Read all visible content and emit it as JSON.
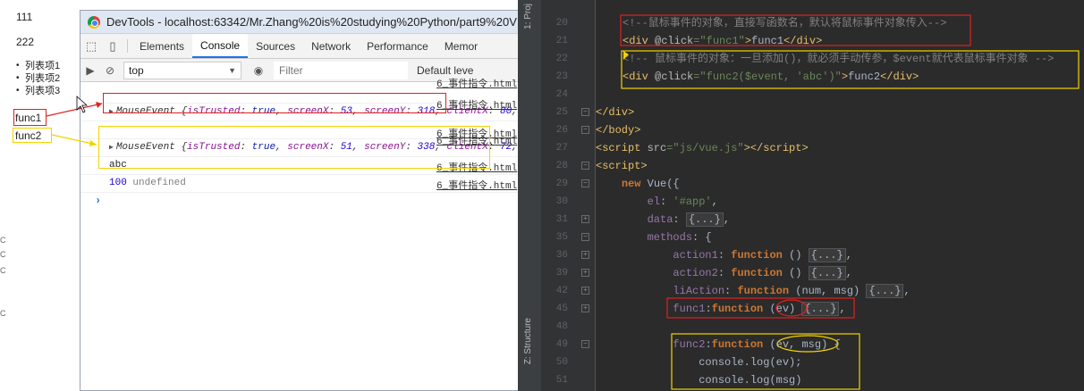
{
  "page": {
    "text_111": "111",
    "text_222": "222",
    "list": [
      "列表项1",
      "列表项2",
      "列表项3"
    ],
    "func1": "func1",
    "func2": "func2",
    "edge_chars": [
      "C",
      "C",
      "C",
      "C"
    ]
  },
  "devtools": {
    "title": "DevTools - localhost:63342/Mr.Zhang%20is%20studying%20Python/part9%20V",
    "tabs": [
      "Elements",
      "Console",
      "Sources",
      "Network",
      "Performance",
      "Memor"
    ],
    "active_tab": "Console",
    "context": "top",
    "filter_placeholder": "Filter",
    "levels": "Default leve",
    "rows": [
      {
        "kind": "object",
        "prefix": "MouseEvent {",
        "k1": "isTrusted",
        "v1": "true",
        "k2": "screenX",
        "v2": "53",
        "k3": "screenY",
        "v3": "318",
        "k4": "clientX",
        "v4": "80",
        "source_top": "6_事件指令.html",
        "source": "6_事件指令.html"
      },
      {
        "kind": "object",
        "prefix": "MouseEvent {",
        "k1": "isTrusted",
        "v1": "true",
        "k2": "screenX",
        "v2": "51",
        "k3": "screenY",
        "v3": "338",
        "k4": "clientX",
        "v4": "72",
        "source_top": "6_事件指令.html",
        "source": "6_事件指令.html"
      },
      {
        "kind": "text",
        "text": "abc",
        "source": "6_事件指令.html"
      },
      {
        "kind": "numundef",
        "num": "100",
        "undef": "undefined",
        "source": "6_事件指令.html"
      }
    ],
    "prompt": "›"
  },
  "ide": {
    "sidebar_top": "1: Proj",
    "sidebar_bottom": "Z: Structure",
    "lines": [
      {
        "n": "20",
        "html": "<span class='c-com'>&lt;!--鼠标事件的对象，直接写函数名，默认将鼠标事件对象传入--&gt;</span>"
      },
      {
        "n": "21",
        "html": "<span class='c-tag'>&lt;div </span><span class='c-attr'>@click</span><span class='c-str'>=\"func1\"</span><span class='c-tag'>&gt;</span><span class='c-def'>func1</span><span class='c-tag'>&lt;/div&gt;</span>"
      },
      {
        "n": "22",
        "html": "<span class='c-com'>&lt;!-- 鼠标事件的对象：一旦添加()，就必须手动传参，$event就代表鼠标事件对象 --&gt;</span>"
      },
      {
        "n": "23",
        "html": "<span class='c-tag'>&lt;div </span><span class='c-attr'>@click</span><span class='c-str'>=\"func2($event, 'abc')\"</span><span class='c-tag'>&gt;</span><span class='c-def'>func2</span><span class='c-tag'>&lt;/div&gt;</span>"
      },
      {
        "n": "24",
        "html": ""
      },
      {
        "n": "25",
        "html": "<span class='c-tag'>&lt;/div&gt;</span>"
      },
      {
        "n": "26",
        "html": "<span class='c-tag'>&lt;/body&gt;</span>"
      },
      {
        "n": "27",
        "html": "<span class='c-tag'>&lt;script </span><span class='c-attr'>src</span><span class='c-str'>=\"js/vue.js\"</span><span class='c-tag'>&gt;&lt;/script&gt;</span>"
      },
      {
        "n": "28",
        "html": "<span class='c-tag'>&lt;script&gt;</span>"
      },
      {
        "n": "29",
        "html": "    <span class='c-kw'>new </span><span class='c-def'>Vue({</span>"
      },
      {
        "n": "30",
        "html": "        <span class='c-key'>el</span><span class='c-def'>: </span><span class='c-str'>'#app'</span><span class='c-def'>,</span>"
      },
      {
        "n": "31",
        "html": "        <span class='c-key'>data</span><span class='c-def'>: </span><span class='c-fold'>{...}</span><span class='c-def'>,</span>"
      },
      {
        "n": "35",
        "html": "        <span class='c-key'>methods</span><span class='c-def'>: {</span>"
      },
      {
        "n": "36",
        "html": "            <span class='c-key'>action1</span><span class='c-def'>: </span><span class='c-kw'>function </span><span class='c-def'>() </span><span class='c-fold'>{...}</span><span class='c-def'>,</span>"
      },
      {
        "n": "39",
        "html": "            <span class='c-key'>action2</span><span class='c-def'>: </span><span class='c-kw'>function </span><span class='c-def'>() </span><span class='c-fold'>{...}</span><span class='c-def'>,</span>"
      },
      {
        "n": "42",
        "html": "            <span class='c-key'>liAction</span><span class='c-def'>: </span><span class='c-kw'>function </span><span class='c-def'>(num, msg) </span><span class='c-fold'>{...}</span><span class='c-def'>,</span>"
      },
      {
        "n": "45",
        "html": "            <span class='c-key'>func1</span><span class='c-def'>:</span><span class='c-kw'>function </span><span class='c-def'>(ev) </span><span class='c-fold'>{...}</span><span class='c-def'>,</span>"
      },
      {
        "n": "48",
        "html": ""
      },
      {
        "n": "49",
        "html": "            <span class='c-key'>func2</span><span class='c-def'>:</span><span class='c-kw'>function </span><span class='c-def'>(ev, msg) {</span>"
      },
      {
        "n": "50",
        "html": "                <span class='c-def'>console.</span><span class='c-fn'>log</span><span class='c-def'>(ev);</span>"
      },
      {
        "n": "51",
        "html": "                <span class='c-def'>console.</span><span class='c-fn'>log</span><span class='c-def'>(msg)</span>"
      }
    ]
  }
}
